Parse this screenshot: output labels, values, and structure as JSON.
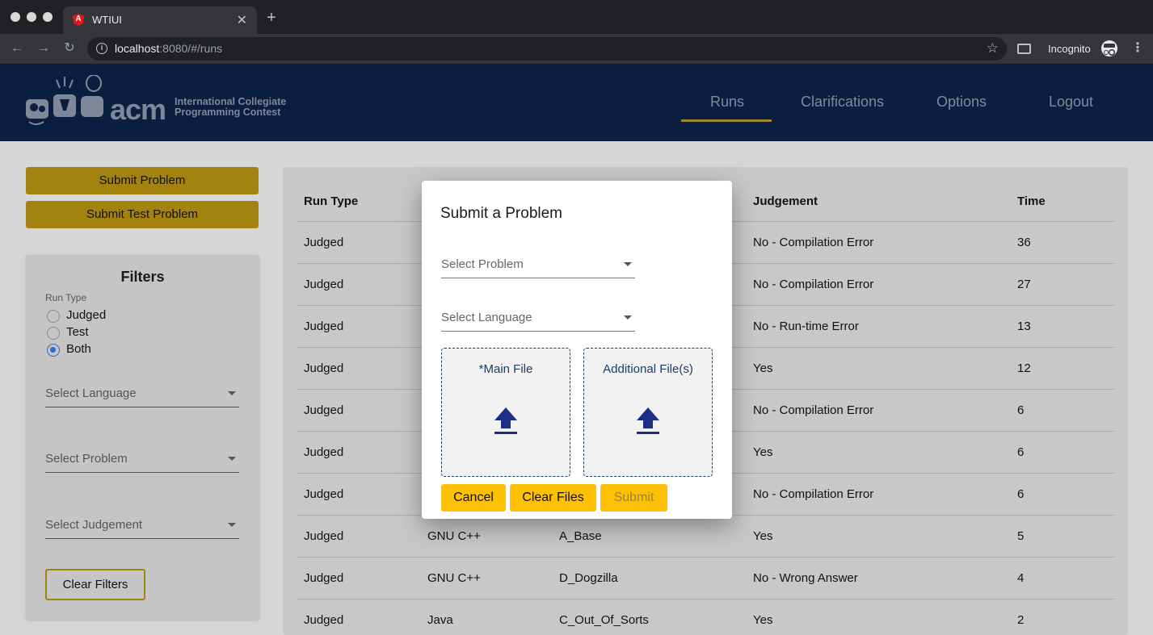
{
  "browser": {
    "tab_title": "WTIUI",
    "tab_favicon_letter": "A",
    "url_host": "localhost",
    "url_rest": ":8080/#/runs",
    "incognito_label": "Incognito"
  },
  "header": {
    "logo_acm": "acm",
    "logo_line1": "International Collegiate",
    "logo_line2": "Programming Contest",
    "nav": [
      {
        "label": "Runs",
        "active": true
      },
      {
        "label": "Clarifications"
      },
      {
        "label": "Options"
      },
      {
        "label": "Logout"
      }
    ]
  },
  "sidebar": {
    "submit_problem": "Submit Problem",
    "submit_test_problem": "Submit Test Problem",
    "filters_title": "Filters",
    "run_type_label": "Run Type",
    "radios": [
      {
        "label": "Judged",
        "checked": false
      },
      {
        "label": "Test",
        "checked": false
      },
      {
        "label": "Both",
        "checked": true
      }
    ],
    "select_language": "Select Language",
    "select_problem": "Select Problem",
    "select_judgement": "Select Judgement",
    "clear_filters": "Clear Filters"
  },
  "table": {
    "headers": {
      "run_type": "Run Type",
      "judgement": "Judgement",
      "time": "Time"
    },
    "rows": [
      {
        "run_type": "Judged",
        "language": "",
        "problem": "",
        "judgement": "No - Compilation Error",
        "time": "36"
      },
      {
        "run_type": "Judged",
        "language": "",
        "problem": "",
        "judgement": "No - Compilation Error",
        "time": "27"
      },
      {
        "run_type": "Judged",
        "language": "",
        "problem": "",
        "judgement": "No - Run-time Error",
        "time": "13"
      },
      {
        "run_type": "Judged",
        "language": "",
        "problem": "",
        "judgement": "Yes",
        "time": "12"
      },
      {
        "run_type": "Judged",
        "language": "",
        "problem": "",
        "judgement": "No - Compilation Error",
        "time": "6"
      },
      {
        "run_type": "Judged",
        "language": "",
        "problem": "",
        "judgement": "Yes",
        "time": "6"
      },
      {
        "run_type": "Judged",
        "language": "",
        "problem": "",
        "judgement": "No - Compilation Error",
        "time": "6"
      },
      {
        "run_type": "Judged",
        "language": "GNU C++",
        "problem": "A_Base",
        "judgement": "Yes",
        "time": "5"
      },
      {
        "run_type": "Judged",
        "language": "GNU C++",
        "problem": "D_Dogzilla",
        "judgement": "No - Wrong Answer",
        "time": "4"
      },
      {
        "run_type": "Judged",
        "language": "Java",
        "problem": "C_Out_Of_Sorts",
        "judgement": "Yes",
        "time": "2"
      }
    ]
  },
  "dialog": {
    "title": "Submit a Problem",
    "select_problem": "Select Problem",
    "select_language": "Select Language",
    "main_file": "*Main File",
    "additional_files": "Additional File(s)",
    "cancel": "Cancel",
    "clear_files": "Clear Files",
    "submit": "Submit"
  },
  "colors": {
    "header_bg": "#0a1e3f",
    "gold": "#fec005",
    "dialog_accent": "#1c3c6e"
  }
}
